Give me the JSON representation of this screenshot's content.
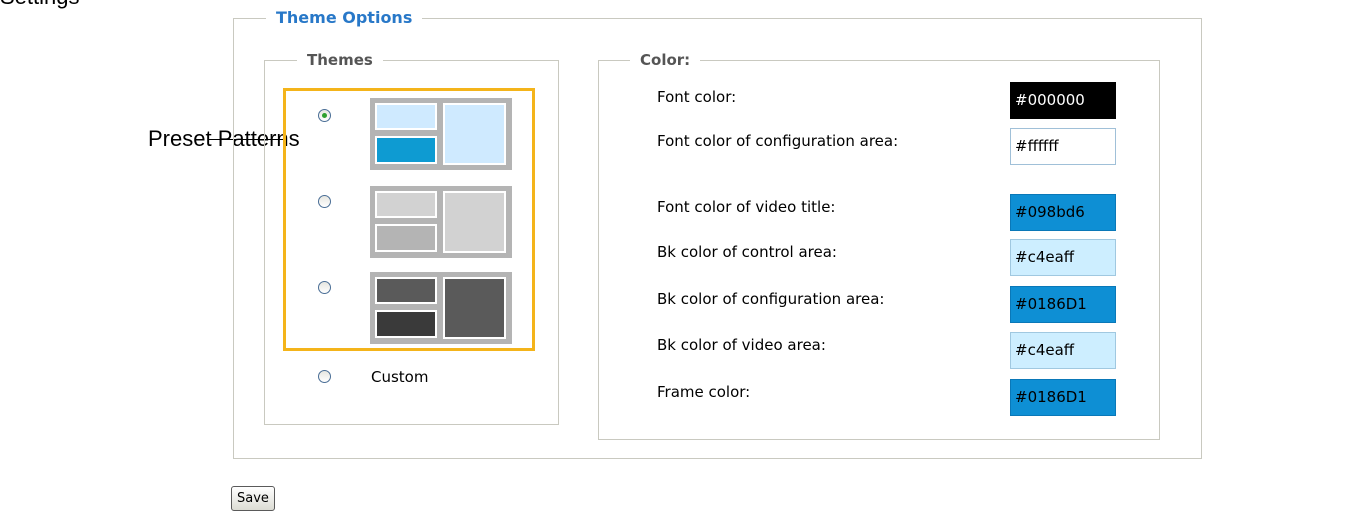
{
  "cut_off_label": "Settings",
  "callout": "Preset Patterns",
  "theme_options": {
    "legend": "Theme Options",
    "themes": {
      "legend": "Themes",
      "presets": [
        {
          "selected": true,
          "colors": {
            "bg": "#b4b4b4",
            "a": "#cfeaff",
            "b": "#0e9bd2",
            "c": "#cfeaff"
          }
        },
        {
          "selected": false,
          "colors": {
            "bg": "#b4b4b4",
            "a": "#d2d2d2",
            "b": "#b4b4b4",
            "c": "#d2d2d2"
          }
        },
        {
          "selected": false,
          "colors": {
            "bg": "#b4b4b4",
            "a": "#5a5a5a",
            "b": "#3a3a3a",
            "c": "#5a5a5a"
          }
        }
      ],
      "custom_label": "Custom"
    },
    "color": {
      "legend": "Color:",
      "rows": [
        {
          "label": "Font color:",
          "value": "#000000",
          "bg": "#000000",
          "fg": "#ffffff",
          "border": "#000000"
        },
        {
          "label": "Font color of configuration area:",
          "value": "#ffffff",
          "bg": "#ffffff",
          "fg": "#000000",
          "border": "#a0c0d8"
        },
        {
          "label": "Font color of video title:",
          "value": "#098bd6",
          "bg": "#0e8fd4",
          "fg": "#000000",
          "border": "#0a78b8"
        },
        {
          "label": "Bk color of control area:",
          "value": "#c4eaff",
          "bg": "#cdeeff",
          "fg": "#000000",
          "border": "#a0c8e0"
        },
        {
          "label": "Bk color of configuration area:",
          "value": "#0186D1",
          "bg": "#0e8fd4",
          "fg": "#000000",
          "border": "#0a78b8"
        },
        {
          "label": "Bk color of video area:",
          "value": "#c4eaff",
          "bg": "#cdeeff",
          "fg": "#000000",
          "border": "#a0c8e0"
        },
        {
          "label": "Frame color:",
          "value": "#0186D1",
          "bg": "#0e8fd4",
          "fg": "#000000",
          "border": "#0a78b8"
        }
      ]
    }
  },
  "save_label": "Save"
}
